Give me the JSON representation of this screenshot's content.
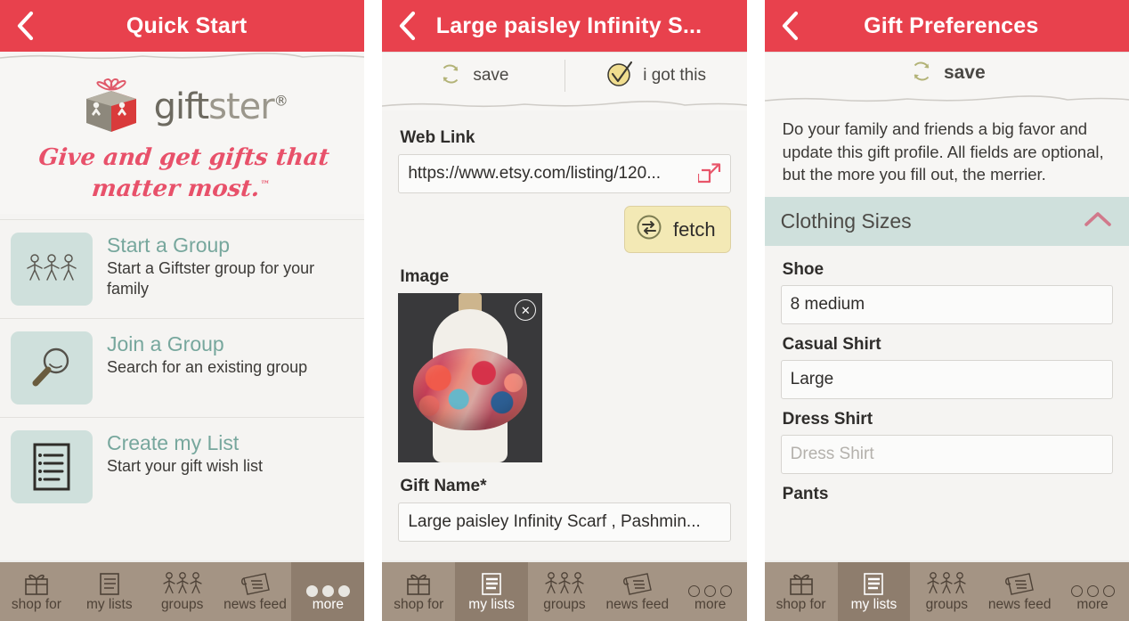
{
  "screen1": {
    "header": {
      "title": "Quick Start",
      "back_icon": "chevron-left-icon"
    },
    "logo": {
      "word1": "gift",
      "word2": "ster",
      "registered": "®",
      "tagline_line1": "Give and get gifts that",
      "tagline_line2": "matter most.",
      "trademark": "™"
    },
    "items": [
      {
        "title": "Start a Group",
        "subtitle": "Start a Giftster group for your family",
        "icon": "people-holding-hands-icon"
      },
      {
        "title": "Join a Group",
        "subtitle": "Search for an existing group",
        "icon": "magnifier-icon"
      },
      {
        "title": "Create my List",
        "subtitle": "Start your gift wish list",
        "icon": "notepad-list-icon"
      }
    ],
    "tabs": [
      {
        "label": "shop for",
        "icon": "gift-box-icon",
        "active": false
      },
      {
        "label": "my lists",
        "icon": "list-icon",
        "active": false
      },
      {
        "label": "groups",
        "icon": "people-holding-hands-icon",
        "active": false
      },
      {
        "label": "news feed",
        "icon": "newspaper-icon",
        "active": false
      },
      {
        "label": "more",
        "icon": "three-dots-icon",
        "active": true
      }
    ]
  },
  "screen2": {
    "header": {
      "title": "Large paisley Infinity S...",
      "back_icon": "chevron-left-icon"
    },
    "actions": [
      {
        "label": "save",
        "icon": "refresh-circle-icon"
      },
      {
        "label": "i got this",
        "icon": "check-circle-icon"
      }
    ],
    "fields": {
      "web_link_label": "Web Link",
      "web_link_value": "https://www.etsy.com/listing/120...",
      "web_link_trailing_icon": "external-link-icon",
      "fetch_label": "fetch",
      "fetch_icon": "swap-arrows-icon",
      "image_label": "Image",
      "image_remove_icon": "close-circle-icon",
      "gift_name_label": "Gift Name*",
      "gift_name_value": "Large paisley Infinity Scarf , Pashmin..."
    },
    "tabs": [
      {
        "label": "shop for",
        "icon": "gift-box-icon",
        "active": false
      },
      {
        "label": "my lists",
        "icon": "list-icon",
        "active": true
      },
      {
        "label": "groups",
        "icon": "people-holding-hands-icon",
        "active": false
      },
      {
        "label": "news feed",
        "icon": "newspaper-icon",
        "active": false
      },
      {
        "label": "more",
        "icon": "three-dots-icon",
        "active": false
      }
    ]
  },
  "screen3": {
    "header": {
      "title": "Gift Preferences",
      "back_icon": "chevron-left-icon"
    },
    "actions": [
      {
        "label": "save",
        "icon": "refresh-circle-icon"
      }
    ],
    "intro": "Do your family and friends a big favor and update this gift profile. All fields are optional, but the more you fill out, the merrier.",
    "section": {
      "title": "Clothing Sizes",
      "chevron_icon": "chevron-up-icon",
      "expanded": true
    },
    "fields": [
      {
        "label": "Shoe",
        "value": "8 medium",
        "placeholder": "Shoe",
        "filled": true
      },
      {
        "label": "Casual Shirt",
        "value": "Large",
        "placeholder": "Casual Shirt",
        "filled": true
      },
      {
        "label": "Dress Shirt",
        "value": "",
        "placeholder": "Dress Shirt",
        "filled": false
      },
      {
        "label": "Pants",
        "value": "",
        "placeholder": "Pants",
        "filled": false
      }
    ],
    "tabs": [
      {
        "label": "shop for",
        "icon": "gift-box-icon",
        "active": false
      },
      {
        "label": "my lists",
        "icon": "list-icon",
        "active": true
      },
      {
        "label": "groups",
        "icon": "people-holding-hands-icon",
        "active": false
      },
      {
        "label": "news feed",
        "icon": "newspaper-icon",
        "active": false
      },
      {
        "label": "more",
        "icon": "three-dots-icon",
        "active": false
      }
    ]
  },
  "colors": {
    "header_red": "#e8414d",
    "teal_accent": "#77a79d",
    "teal_panel": "#cfe0dc",
    "tabbar_brown": "#a49484",
    "tab_active_brown": "#8e7d6d",
    "fetch_yellow": "#f3e9b5",
    "tagline_pink": "#e8516a"
  }
}
